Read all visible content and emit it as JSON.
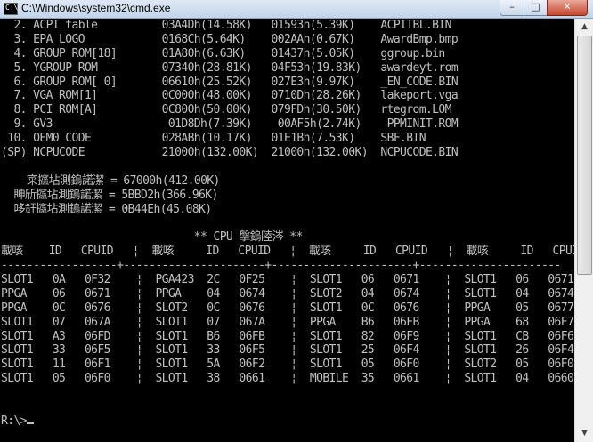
{
  "window": {
    "title": "C:\\Windows\\system32\\cmd.exe",
    "icon_text": "C:\\",
    "controls": {
      "minimize": "–",
      "maximize": "□",
      "close": "✕"
    }
  },
  "console": {
    "lines": [
      "  2. ACPI table          03A4Dh(14.58K)   01593h(5.39K)    ACPITBL.BIN",
      "  3. EPA LOGO            0168Ch(5.64K)    002AAh(0.67K)    AwardBmp.bmp",
      "  4. GROUP ROM[18]       01A80h(6.63K)    01437h(5.05K)    ggroup.bin",
      "  5. YGROUP ROM          07340h(28.81K)   04F53h(19.83K)   awardeyt.rom",
      "  6. GROUP ROM[ 0]       06610h(25.52K)   027E3h(9.97K)    _EN_CODE.BIN",
      "  7. VGA ROM[1]          0C000h(48.00K)   0710Dh(28.26K)   lakeport.vga",
      "  8. PCI ROM[A]          0C800h(50.00K)   079FDh(30.50K)   rtegrom.LOM",
      "  9. GV3                  01D8Dh(7.39K)    00AF5h(2.74K)    PPMINIT.ROM",
      " 10. OEM0 CODE           028ABh(10.17K)   01E1Bh(7.53K)    SBF.BIN",
      "(SP) NCPUCODE            21000h(132.00K)  21000h(132.00K)  NCPUCODE.BIN",
      "",
      "    寀攨坫測鎢諾潔 = 67000h(412.00K)",
      "  眒斦攨坫測鎢諾潔 = 5BBD2h(366.96K)",
      "  哆釬攨坫測鎢諾潔 = 0B44Eh(45.08K)",
      "",
      "                              ** CPU 搫鎢陸涔 **",
      "載咳    ID   CPUID   ¦  載咳     ID   CPUID   ¦  載咳     ID   CPUID   ¦  載咳     ID   CPUID",
      "------------------+----------------------+----------------------+----------------------",
      "SLOT1   0A   0F32    ¦  PGA423  2C   0F25    ¦  SLOT1   06   0671    ¦  SLOT1   06   0671",
      "PPGA    06   0671    ¦  PPGA    04   0674    ¦  SLOT2   04   0674    ¦  SLOT1   04   0674",
      "PPGA    0C   0676    ¦  SLOT2   0C   0676    ¦  SLOT1   0C   0676    ¦  PPGA    05   0677",
      "SLOT1   07   067A    ¦  SLOT1   07   067A    ¦  PPGA    B6   06FB    ¦  PPGA    68   06F7",
      "SLOT1   A3   06FD    ¦  SLOT1   B6   06FB    ¦  SLOT1   82   06F9    ¦  SLOT1   CB   06F6",
      "SLOT1   33   06F5    ¦  SLOT1   33   06F5    ¦  SLOT1   25   06F4    ¦  SLOT1   26   06F4",
      "SLOT1   11   06F1    ¦  SLOT1   5A   06F2    ¦  SLOT1   05   06F0    ¦  SLOT2   05   06F0",
      "SLOT1   05   06F0    ¦  SLOT1   38   0661    ¦  MOBILE  35   0661    ¦  SLOT1   04   0660",
      "",
      ""
    ],
    "prompt": "R:\\>"
  }
}
